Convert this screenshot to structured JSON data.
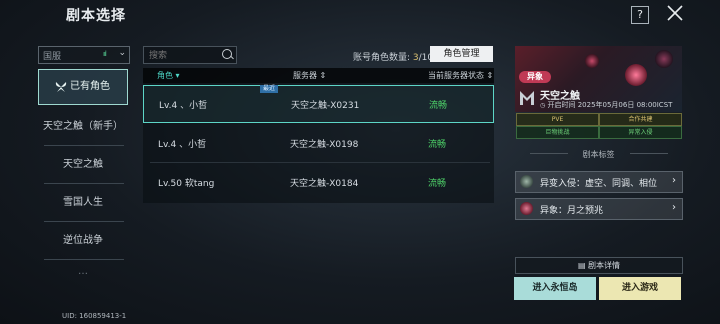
{
  "header": {
    "title": "剧本选择",
    "help_label": "?"
  },
  "sidebar": {
    "server_select": {
      "value": "国服",
      "signal": "ııl",
      "chevron": "⌄"
    },
    "items": [
      {
        "label": "已有角色"
      },
      {
        "label": "天空之触（新手）"
      },
      {
        "label": "天空之触"
      },
      {
        "label": "雪国人生"
      },
      {
        "label": "逆位战争"
      },
      {
        "label": "…"
      }
    ],
    "uid": "UID: 160859413-1"
  },
  "main": {
    "search_placeholder": "搜索",
    "count_label": "账号角色数量: ",
    "count_current": "3",
    "count_total": "/10",
    "manage_button": "角色管理",
    "columns": {
      "role": "角色 ▾",
      "server": "服务器 ⇕",
      "status": "当前服务器状态 ⇕"
    },
    "rows": [
      {
        "role": "Lv.4 、小哲",
        "server": "天空之触-X0231",
        "status": "流畅",
        "badge": "最近"
      },
      {
        "role": "Lv.4 、小哲",
        "server": "天空之触-X0198",
        "status": "流畅",
        "badge": ""
      },
      {
        "role": "Lv.50 软tang",
        "server": "天空之触-X0184",
        "status": "流畅",
        "badge": ""
      }
    ]
  },
  "panel": {
    "anomaly_tag": "异象",
    "scenario_name": "天空之触",
    "open_time": "开启时间 2025年05月06日 08:00ICST",
    "tags_grid": [
      "PVE",
      "合作共建",
      "巨物挑战",
      "异常入侵"
    ],
    "tags_title": "剧本标签",
    "tag_buttons": [
      {
        "label": "异变入侵：虚空、同调、相位"
      },
      {
        "label": "异象：月之预兆"
      }
    ],
    "details_button": "剧本详情",
    "island_button": "进入永恒岛",
    "enter_button": "进入游戏"
  },
  "colors": {
    "accent": "#5dd6c7",
    "status_ok": "#4fd56a",
    "enter_bg": "#ece7b2",
    "island_bg": "#a9dcd9",
    "anomaly": "#c03a55"
  },
  "icons": [
    "close-icon",
    "search-icon",
    "chevron-down-icon",
    "signal-icon",
    "butterfly-icon",
    "calendar-icon",
    "document-icon",
    "arrow-right-icon"
  ]
}
